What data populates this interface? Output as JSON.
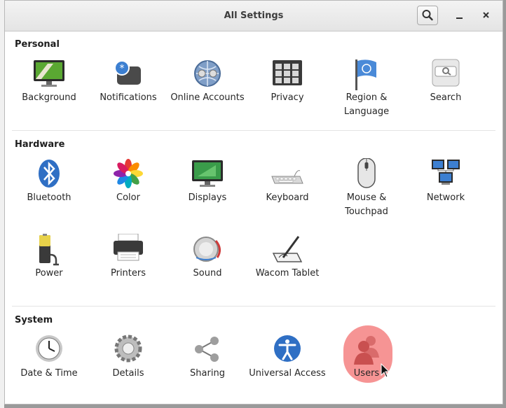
{
  "window": {
    "title": "All Settings"
  },
  "sections": [
    {
      "title": "Personal",
      "items": [
        {
          "label": "Background",
          "icon": "background-icon"
        },
        {
          "label": "Notifications",
          "icon": "notifications-icon"
        },
        {
          "label": "Online Accounts",
          "icon": "online-accounts-icon"
        },
        {
          "label": "Privacy",
          "icon": "privacy-icon"
        },
        {
          "label": "Region & Language",
          "icon": "region-language-icon"
        },
        {
          "label": "Search",
          "icon": "search-settings-icon"
        }
      ]
    },
    {
      "title": "Hardware",
      "items": [
        {
          "label": "Bluetooth",
          "icon": "bluetooth-icon"
        },
        {
          "label": "Color",
          "icon": "color-icon"
        },
        {
          "label": "Displays",
          "icon": "displays-icon"
        },
        {
          "label": "Keyboard",
          "icon": "keyboard-icon"
        },
        {
          "label": "Mouse & Touchpad",
          "icon": "mouse-touchpad-icon"
        },
        {
          "label": "Network",
          "icon": "network-icon"
        },
        {
          "label": "Power",
          "icon": "power-icon"
        },
        {
          "label": "Printers",
          "icon": "printers-icon"
        },
        {
          "label": "Sound",
          "icon": "sound-icon"
        },
        {
          "label": "Wacom Tablet",
          "icon": "wacom-tablet-icon"
        }
      ]
    },
    {
      "title": "System",
      "items": [
        {
          "label": "Date & Time",
          "icon": "date-time-icon"
        },
        {
          "label": "Details",
          "icon": "details-icon"
        },
        {
          "label": "Sharing",
          "icon": "sharing-icon"
        },
        {
          "label": "Universal Access",
          "icon": "universal-access-icon"
        },
        {
          "label": "Users",
          "icon": "users-icon",
          "highlighted": true
        }
      ]
    }
  ],
  "colors": {
    "highlight": "#ee3c3c",
    "bluetooth": "#2f6fc4",
    "accent": "#3a79c9"
  }
}
